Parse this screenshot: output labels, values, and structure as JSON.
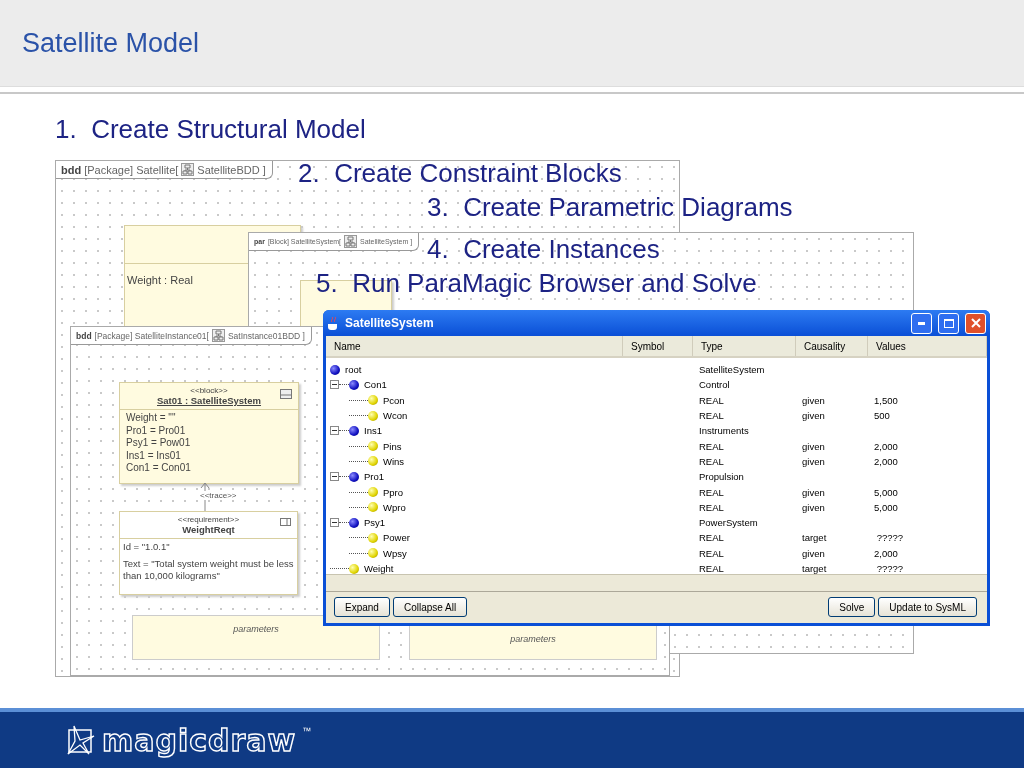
{
  "header": {
    "title": "Satellite Model"
  },
  "steps": [
    {
      "number": "1.",
      "label": "Create Structural Model"
    },
    {
      "number": "2.",
      "label": "Create Constraint Blocks"
    },
    {
      "number": "3.",
      "label": "Create Parametric Diagrams"
    },
    {
      "number": "4.",
      "label": "Create Instances"
    },
    {
      "number": "5.",
      "label": "Run ParaMagic Browser and Solve"
    }
  ],
  "structure_diagram": {
    "frame_label": {
      "kind": "bdd",
      "context": "[Package] Satellite[",
      "name": "SatelliteBDD ]"
    },
    "block_attribute": "Weight : Real"
  },
  "parametric_diagram": {
    "frame_label": {
      "kind": "par",
      "context": "[Block] SatelliteSystem[",
      "name": "SatelliteSystem ]"
    }
  },
  "instance_diagram": {
    "frame_label": {
      "kind": "bdd",
      "context": "[Package] SatelliteInstance01[",
      "name": "SatInstance01BDD ]"
    },
    "instance": {
      "stereotype": "<<block>>",
      "name": "Sat01 : SatelliteSystem",
      "slots": [
        "Weight = \"\"",
        "Pro1 = Pro01",
        "Psy1 = Pow01",
        "Ins1 = Ins01",
        "Con1 = Con01"
      ]
    },
    "trace": "<<trace>>",
    "requirement": {
      "stereotype": "<<requirement>>",
      "name": "WeightReqt",
      "properties": [
        "Id = \"1.0.1\"",
        "Text = \"Total system weight must be less than 10,000 kilograms\""
      ]
    },
    "parameter_blocks": [
      "parameters",
      "parameters"
    ]
  },
  "window": {
    "title": "SatelliteSystem",
    "columns": [
      "Name",
      "Symbol",
      "Type",
      "Causality",
      "Values"
    ],
    "tree": [
      {
        "name": "root",
        "kind": "object",
        "type": "SatelliteSystem",
        "children": [
          {
            "name": "Con1",
            "kind": "object",
            "expanded": true,
            "type": "Control",
            "children": [
              {
                "name": "Pcon",
                "kind": "parameter",
                "type": "REAL",
                "causality": "given",
                "values": "1,500"
              },
              {
                "name": "Wcon",
                "kind": "parameter",
                "type": "REAL",
                "causality": "given",
                "values": "500"
              }
            ]
          },
          {
            "name": "Ins1",
            "kind": "object",
            "expanded": true,
            "type": "Instruments",
            "children": [
              {
                "name": "Pins",
                "kind": "parameter",
                "type": "REAL",
                "causality": "given",
                "values": "2,000"
              },
              {
                "name": "Wins",
                "kind": "parameter",
                "type": "REAL",
                "causality": "given",
                "values": "2,000"
              }
            ]
          },
          {
            "name": "Pro1",
            "kind": "object",
            "expanded": true,
            "type": "Propulsion",
            "children": [
              {
                "name": "Ppro",
                "kind": "parameter",
                "type": "REAL",
                "causality": "given",
                "values": "5,000"
              },
              {
                "name": "Wpro",
                "kind": "parameter",
                "type": "REAL",
                "causality": "given",
                "values": "5,000"
              }
            ]
          },
          {
            "name": "Psy1",
            "kind": "object",
            "expanded": true,
            "type": "PowerSystem",
            "children": [
              {
                "name": "Power",
                "kind": "parameter",
                "type": "REAL",
                "causality": "target",
                "values": " ?????"
              },
              {
                "name": "Wpsy",
                "kind": "parameter",
                "type": "REAL",
                "causality": "given",
                "values": "2,000"
              }
            ]
          },
          {
            "name": "Weight",
            "kind": "parameter",
            "type": "REAL",
            "causality": "target",
            "values": " ?????"
          }
        ]
      }
    ],
    "buttons_left": [
      "Expand",
      "Collapse All"
    ],
    "buttons_right": [
      "Solve",
      "Update to SysML"
    ]
  },
  "footer": {
    "logo": "magicdraw",
    "trademark": "™"
  }
}
